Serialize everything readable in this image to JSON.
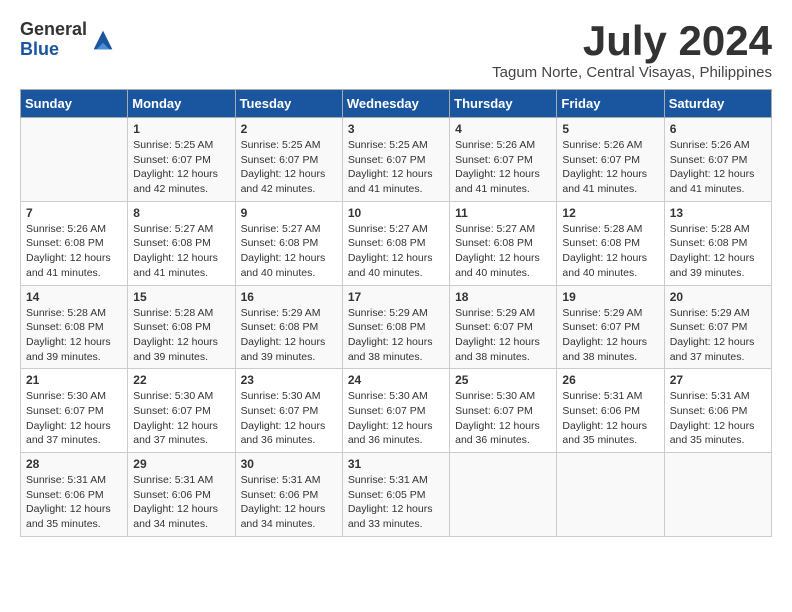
{
  "header": {
    "logo_general": "General",
    "logo_blue": "Blue",
    "month_title": "July 2024",
    "location": "Tagum Norte, Central Visayas, Philippines"
  },
  "calendar": {
    "weekdays": [
      "Sunday",
      "Monday",
      "Tuesday",
      "Wednesday",
      "Thursday",
      "Friday",
      "Saturday"
    ],
    "weeks": [
      [
        {
          "day": "",
          "info": ""
        },
        {
          "day": "1",
          "info": "Sunrise: 5:25 AM\nSunset: 6:07 PM\nDaylight: 12 hours\nand 42 minutes."
        },
        {
          "day": "2",
          "info": "Sunrise: 5:25 AM\nSunset: 6:07 PM\nDaylight: 12 hours\nand 42 minutes."
        },
        {
          "day": "3",
          "info": "Sunrise: 5:25 AM\nSunset: 6:07 PM\nDaylight: 12 hours\nand 41 minutes."
        },
        {
          "day": "4",
          "info": "Sunrise: 5:26 AM\nSunset: 6:07 PM\nDaylight: 12 hours\nand 41 minutes."
        },
        {
          "day": "5",
          "info": "Sunrise: 5:26 AM\nSunset: 6:07 PM\nDaylight: 12 hours\nand 41 minutes."
        },
        {
          "day": "6",
          "info": "Sunrise: 5:26 AM\nSunset: 6:07 PM\nDaylight: 12 hours\nand 41 minutes."
        }
      ],
      [
        {
          "day": "7",
          "info": "Sunrise: 5:26 AM\nSunset: 6:08 PM\nDaylight: 12 hours\nand 41 minutes."
        },
        {
          "day": "8",
          "info": "Sunrise: 5:27 AM\nSunset: 6:08 PM\nDaylight: 12 hours\nand 41 minutes."
        },
        {
          "day": "9",
          "info": "Sunrise: 5:27 AM\nSunset: 6:08 PM\nDaylight: 12 hours\nand 40 minutes."
        },
        {
          "day": "10",
          "info": "Sunrise: 5:27 AM\nSunset: 6:08 PM\nDaylight: 12 hours\nand 40 minutes."
        },
        {
          "day": "11",
          "info": "Sunrise: 5:27 AM\nSunset: 6:08 PM\nDaylight: 12 hours\nand 40 minutes."
        },
        {
          "day": "12",
          "info": "Sunrise: 5:28 AM\nSunset: 6:08 PM\nDaylight: 12 hours\nand 40 minutes."
        },
        {
          "day": "13",
          "info": "Sunrise: 5:28 AM\nSunset: 6:08 PM\nDaylight: 12 hours\nand 39 minutes."
        }
      ],
      [
        {
          "day": "14",
          "info": "Sunrise: 5:28 AM\nSunset: 6:08 PM\nDaylight: 12 hours\nand 39 minutes."
        },
        {
          "day": "15",
          "info": "Sunrise: 5:28 AM\nSunset: 6:08 PM\nDaylight: 12 hours\nand 39 minutes."
        },
        {
          "day": "16",
          "info": "Sunrise: 5:29 AM\nSunset: 6:08 PM\nDaylight: 12 hours\nand 39 minutes."
        },
        {
          "day": "17",
          "info": "Sunrise: 5:29 AM\nSunset: 6:08 PM\nDaylight: 12 hours\nand 38 minutes."
        },
        {
          "day": "18",
          "info": "Sunrise: 5:29 AM\nSunset: 6:07 PM\nDaylight: 12 hours\nand 38 minutes."
        },
        {
          "day": "19",
          "info": "Sunrise: 5:29 AM\nSunset: 6:07 PM\nDaylight: 12 hours\nand 38 minutes."
        },
        {
          "day": "20",
          "info": "Sunrise: 5:29 AM\nSunset: 6:07 PM\nDaylight: 12 hours\nand 37 minutes."
        }
      ],
      [
        {
          "day": "21",
          "info": "Sunrise: 5:30 AM\nSunset: 6:07 PM\nDaylight: 12 hours\nand 37 minutes."
        },
        {
          "day": "22",
          "info": "Sunrise: 5:30 AM\nSunset: 6:07 PM\nDaylight: 12 hours\nand 37 minutes."
        },
        {
          "day": "23",
          "info": "Sunrise: 5:30 AM\nSunset: 6:07 PM\nDaylight: 12 hours\nand 36 minutes."
        },
        {
          "day": "24",
          "info": "Sunrise: 5:30 AM\nSunset: 6:07 PM\nDaylight: 12 hours\nand 36 minutes."
        },
        {
          "day": "25",
          "info": "Sunrise: 5:30 AM\nSunset: 6:07 PM\nDaylight: 12 hours\nand 36 minutes."
        },
        {
          "day": "26",
          "info": "Sunrise: 5:31 AM\nSunset: 6:06 PM\nDaylight: 12 hours\nand 35 minutes."
        },
        {
          "day": "27",
          "info": "Sunrise: 5:31 AM\nSunset: 6:06 PM\nDaylight: 12 hours\nand 35 minutes."
        }
      ],
      [
        {
          "day": "28",
          "info": "Sunrise: 5:31 AM\nSunset: 6:06 PM\nDaylight: 12 hours\nand 35 minutes."
        },
        {
          "day": "29",
          "info": "Sunrise: 5:31 AM\nSunset: 6:06 PM\nDaylight: 12 hours\nand 34 minutes."
        },
        {
          "day": "30",
          "info": "Sunrise: 5:31 AM\nSunset: 6:06 PM\nDaylight: 12 hours\nand 34 minutes."
        },
        {
          "day": "31",
          "info": "Sunrise: 5:31 AM\nSunset: 6:05 PM\nDaylight: 12 hours\nand 33 minutes."
        },
        {
          "day": "",
          "info": ""
        },
        {
          "day": "",
          "info": ""
        },
        {
          "day": "",
          "info": ""
        }
      ]
    ]
  }
}
